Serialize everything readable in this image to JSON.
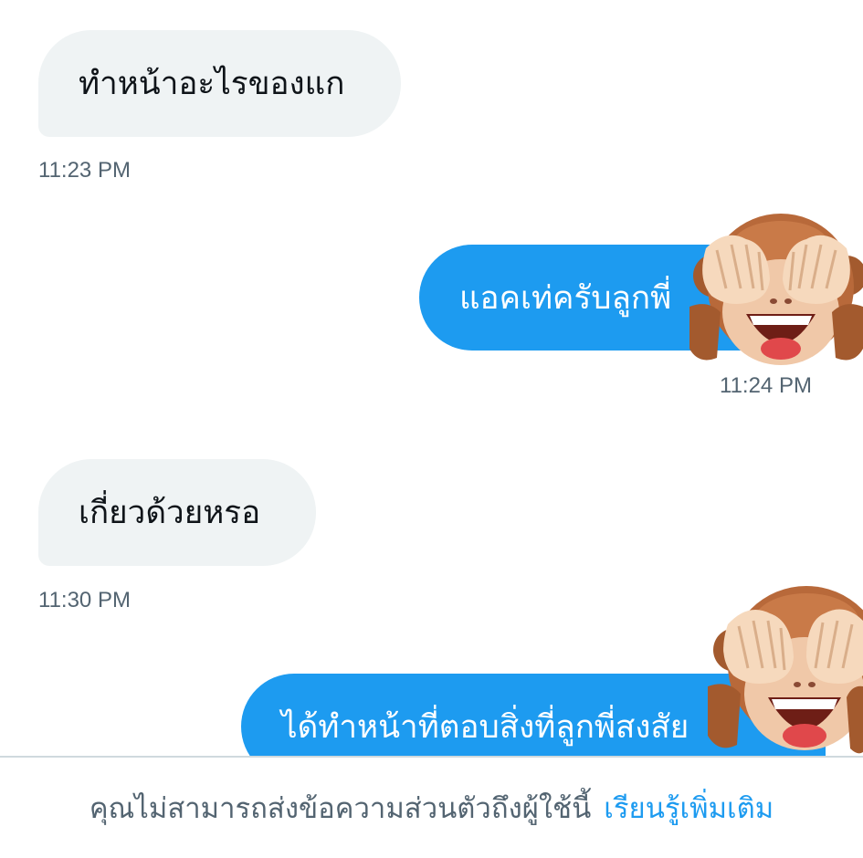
{
  "messages": [
    {
      "direction": "incoming",
      "text": "ทำหน้าอะไรของแก",
      "time": "11:23 PM"
    },
    {
      "direction": "outgoing",
      "text": "แอคเท่ครับลูกพี่",
      "time": "11:24 PM"
    },
    {
      "direction": "incoming",
      "text": "เกี่ยวด้วยหรอ",
      "time": "11:30 PM"
    },
    {
      "direction": "outgoing",
      "text": "ได้ทำหน้าที่ตอบสิ่งที่ลูกพี่สงสัย"
    }
  ],
  "stickers": [
    {
      "name": "see-no-evil monkey",
      "emoji": "🙈"
    },
    {
      "name": "see-no-evil monkey",
      "emoji": "🙈"
    }
  ],
  "footer": {
    "notice": "คุณไม่สามารถส่งข้อความส่วนตัวถึงผู้ใช้นี้",
    "link": "เรียนรู้เพิ่มเติม"
  },
  "colors": {
    "incoming_bubble": "#eff3f4",
    "outgoing_bubble": "#1d9bf0",
    "timestamp": "#536471",
    "link": "#1d9bf0"
  }
}
